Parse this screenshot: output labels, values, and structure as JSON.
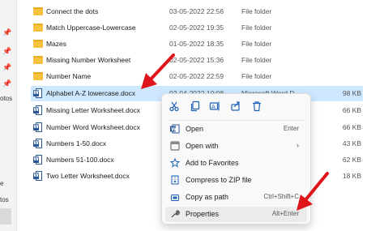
{
  "sidebar": {
    "label_top": "otos",
    "label_bottom_1": "e",
    "label_bottom_2": "tos"
  },
  "files": [
    {
      "name": "Connect the dots",
      "date": "03-05-2022 22:56",
      "type": "File folder",
      "size": "",
      "kind": "folder"
    },
    {
      "name": "Match Uppercase-Lowercase",
      "date": "02-05-2022 19:35",
      "type": "File folder",
      "size": "",
      "kind": "folder"
    },
    {
      "name": "Mazes",
      "date": "01-05-2022 18:35",
      "type": "File folder",
      "size": "",
      "kind": "folder"
    },
    {
      "name": "Missing Number Worksheet",
      "date": "02-05-2022 15:36",
      "type": "File folder",
      "size": "",
      "kind": "folder"
    },
    {
      "name": "Number Name",
      "date": "02-05-2022 22:59",
      "type": "File folder",
      "size": "",
      "kind": "folder"
    },
    {
      "name": "Alphabet A-Z lowercase.docx",
      "date": "02-04-2022 10:08",
      "type": "Microsoft Word D...",
      "size": "98 KB",
      "kind": "word"
    },
    {
      "name": "Missing Letter Worksheet.docx",
      "date": "",
      "type": "",
      "size": "66 KB",
      "kind": "word"
    },
    {
      "name": "Number Word Worksheet.docx",
      "date": "",
      "type": "",
      "size": "66 KB",
      "kind": "word"
    },
    {
      "name": "Numbers 1-50.docx",
      "date": "",
      "type": "",
      "size": "43 KB",
      "kind": "word"
    },
    {
      "name": "Numbers 51-100.docx",
      "date": "",
      "type": "",
      "size": "62 KB",
      "kind": "word"
    },
    {
      "name": "Two Letter Worksheet.docx",
      "date": "",
      "type": "",
      "size": "18 KB",
      "kind": "word"
    }
  ],
  "context_menu": {
    "toolbar": [
      {
        "icon": "cut-icon"
      },
      {
        "icon": "copy-icon"
      },
      {
        "icon": "rename-icon"
      },
      {
        "icon": "share-icon"
      },
      {
        "icon": "delete-icon"
      }
    ],
    "items": [
      {
        "label": "Open",
        "shortcut": "Enter",
        "icon": "word-icon"
      },
      {
        "label": "Open with",
        "shortcut": "",
        "icon": "open-with-icon",
        "submenu": true
      },
      {
        "label": "Add to Favorites",
        "shortcut": "",
        "icon": "star-icon"
      },
      {
        "label": "Compress to ZIP file",
        "shortcut": "",
        "icon": "zip-icon"
      },
      {
        "label": "Copy as path",
        "shortcut": "Ctrl+Shift+C",
        "icon": "copy-path-icon"
      },
      {
        "label": "Properties",
        "shortcut": "Alt+Enter",
        "icon": "wrench-icon"
      }
    ]
  },
  "colors": {
    "annotation_arrow": "#e0141b",
    "selection": "#cde8ff",
    "word_blue": "#2b5797",
    "folder": "#f6c23e"
  }
}
